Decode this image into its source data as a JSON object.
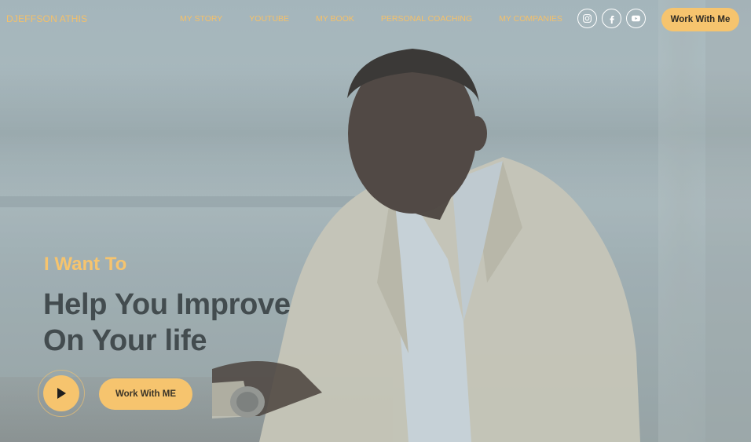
{
  "brand": "DJEFFSON ATHIS",
  "nav": {
    "items": [
      {
        "label": "MY STORY"
      },
      {
        "label": "YOUTUBE"
      },
      {
        "label": "MY BOOK"
      },
      {
        "label": "PERSONAL COACHING"
      },
      {
        "label": "MY COMPANIES"
      }
    ],
    "socials": [
      "instagram-icon",
      "facebook-icon",
      "youtube-icon"
    ],
    "cta_label": "Work With Me"
  },
  "hero": {
    "kicker": "I Want To",
    "headline_line1": "Help You Improve",
    "headline_line2": "On Your life",
    "cta_label": "Work With ME",
    "play_icon": "play-icon"
  },
  "colors": {
    "accent": "#f6c46e",
    "headline": "#434c4f",
    "overlay": "#a9b8bc"
  }
}
